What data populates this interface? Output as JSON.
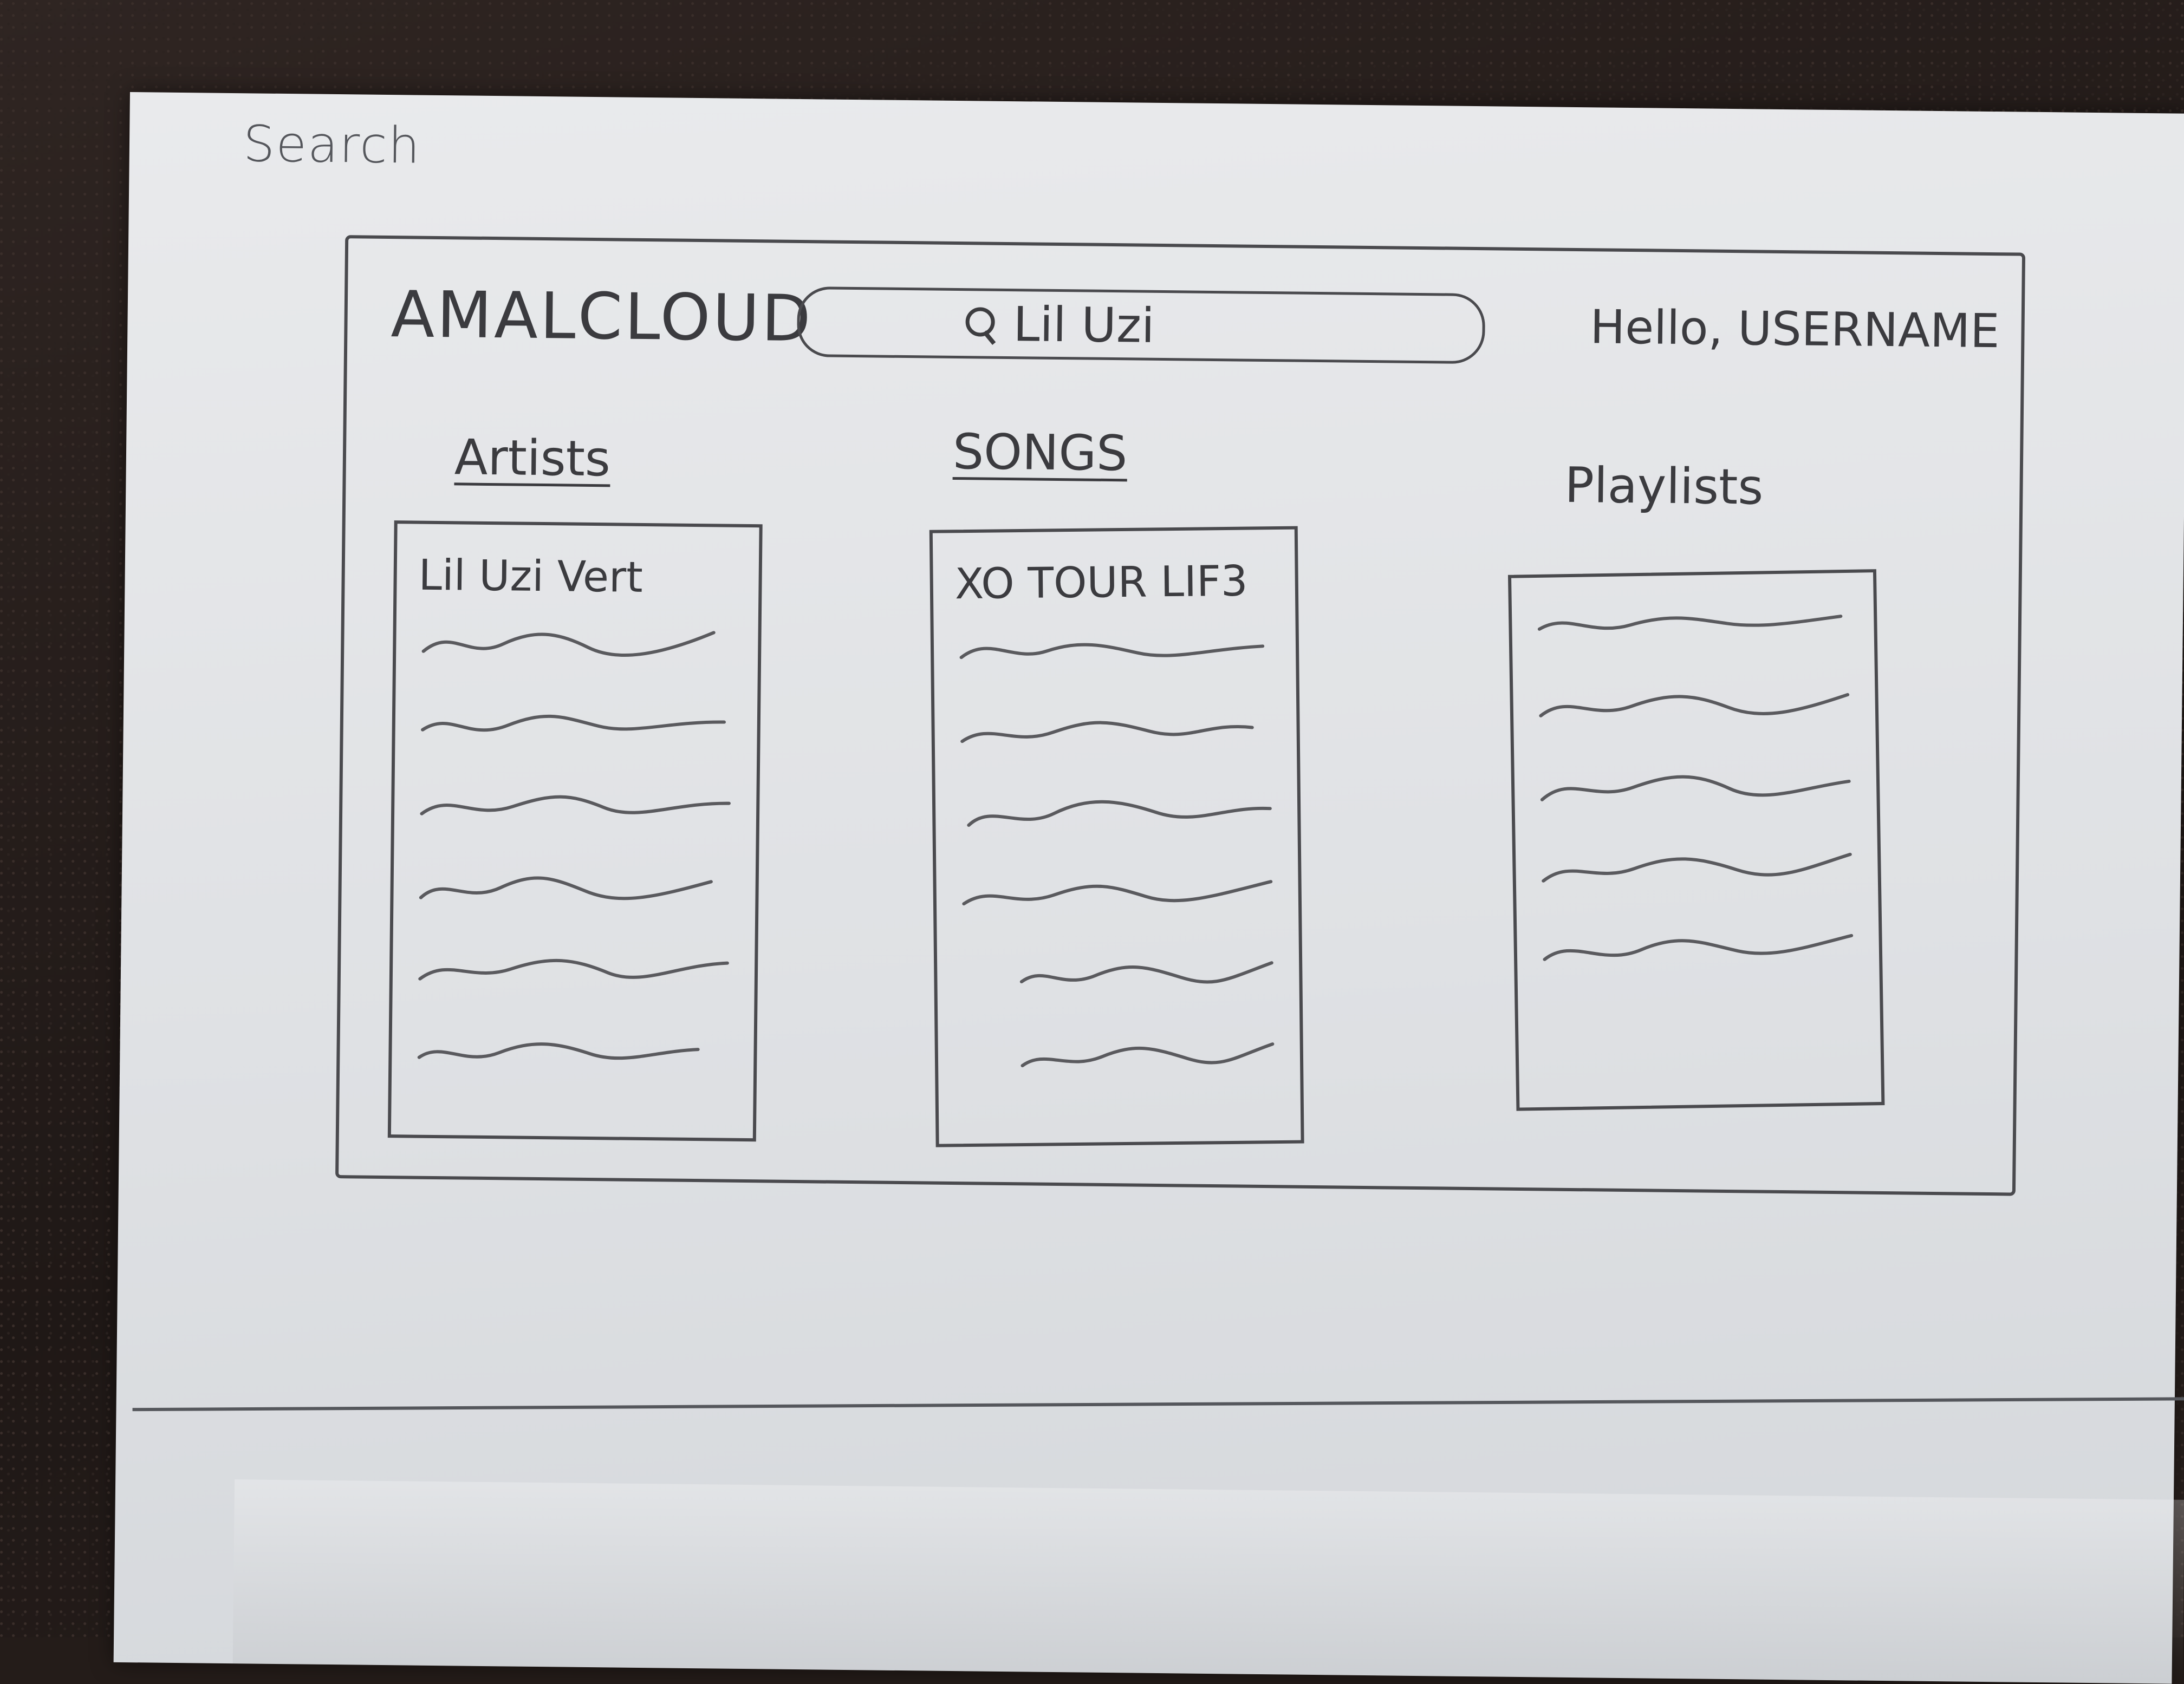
{
  "page": {
    "label": "Search"
  },
  "header": {
    "brand": "AMALCLOUD",
    "search_value": "Lil Uzi",
    "greeting": "Hello, USERNAME"
  },
  "columns": {
    "artists": {
      "heading": "Artists",
      "first_item": "Lil Uzi Vert",
      "placeholder_rows": 6
    },
    "songs": {
      "heading": "SONGS",
      "first_item": "XO TOUR LIF3",
      "placeholder_rows": 6
    },
    "playlists": {
      "heading": "Playlists",
      "placeholder_rows": 5
    }
  },
  "icons": {
    "search": "search-icon"
  },
  "colors": {
    "pencil": "#3d3d40",
    "paper": "#e4e6e9"
  }
}
